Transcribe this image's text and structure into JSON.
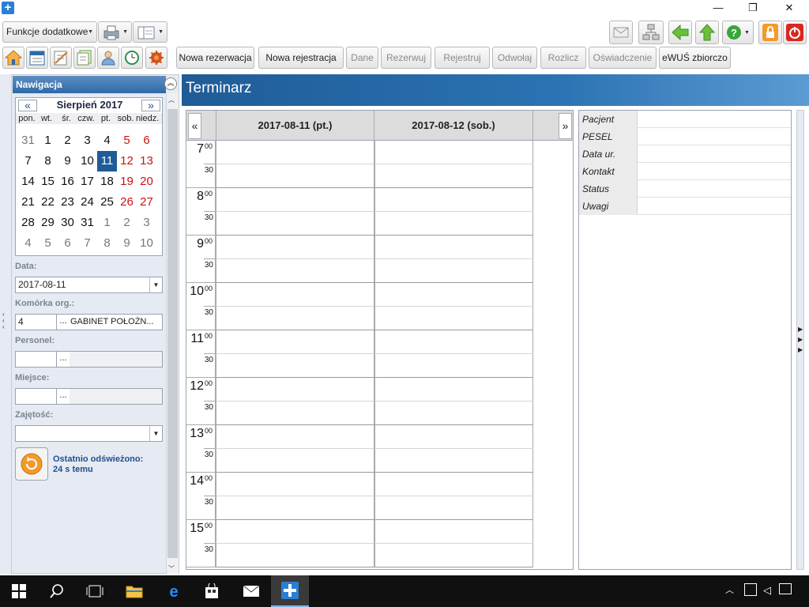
{
  "window": {
    "minimize": "—",
    "restore": "❐",
    "close": "✕"
  },
  "toolbar": {
    "funkcje_label": "Funkcje dodatkowe",
    "icons": [
      "home-icon",
      "calendar-icon",
      "notes-icon",
      "documents-icon",
      "patients-icon",
      "refresh-schedule-icon",
      "settings-icon"
    ],
    "actions": [
      {
        "label": "Nowa rezerwacja",
        "enabled": true
      },
      {
        "label": "Nowa rejestracja",
        "enabled": true
      },
      {
        "label": "Dane",
        "enabled": false
      },
      {
        "label": "Rezerwuj",
        "enabled": false
      },
      {
        "label": "Rejestruj",
        "enabled": false
      },
      {
        "label": "Odwołaj",
        "enabled": false
      },
      {
        "label": "Rozlicz",
        "enabled": false
      },
      {
        "label": "Oświadczenie",
        "enabled": false
      },
      {
        "label": "eWUŚ zbiorczo",
        "enabled": true
      }
    ]
  },
  "nav": {
    "title": "Nawigacja",
    "calendar": {
      "prev": "«",
      "next": "»",
      "month": "Sierpień 2017",
      "weekdays": [
        "pon.",
        "wt.",
        "śr.",
        "czw.",
        "pt.",
        "sob.",
        "niedz."
      ],
      "weeks": [
        [
          "31",
          "1",
          "2",
          "3",
          "4",
          "5",
          "6"
        ],
        [
          "7",
          "8",
          "9",
          "10",
          "11",
          "12",
          "13"
        ],
        [
          "14",
          "15",
          "16",
          "17",
          "18",
          "19",
          "20"
        ],
        [
          "21",
          "22",
          "23",
          "24",
          "25",
          "26",
          "27"
        ],
        [
          "28",
          "29",
          "30",
          "31",
          "1",
          "2",
          "3"
        ],
        [
          "4",
          "5",
          "6",
          "7",
          "8",
          "9",
          "10"
        ]
      ],
      "selected": "11"
    },
    "data_label": "Data:",
    "data_value": "2017-08-11",
    "komorka_label": "Komórka org.:",
    "komorka_code": "4",
    "komorka_name": "GABINET POŁOŻN...",
    "personel_label": "Personel:",
    "miejsce_label": "Miejsce:",
    "zajetosc_label": "Zajętość:",
    "refresh_line1": "Ostatnio odświeżono:",
    "refresh_line2": "24 s temu",
    "dots": "..."
  },
  "main": {
    "title": "Terminarz",
    "prev": "«",
    "next": "»",
    "days": [
      "2017-08-11 (pt.)",
      "2017-08-12 (sob.)"
    ],
    "hours": [
      "7",
      "8",
      "9",
      "10",
      "11",
      "12",
      "13",
      "14",
      "15"
    ],
    "minute_top": "00",
    "minute_half": "30"
  },
  "info": {
    "rows": [
      "Pacjent",
      "PESEL",
      "Data ur.",
      "Kontakt",
      "Status",
      "Uwagi"
    ]
  },
  "colors": {
    "accent": "#1f5c97",
    "weekend": "#cc1111",
    "selected_day": "#1f5c97"
  }
}
